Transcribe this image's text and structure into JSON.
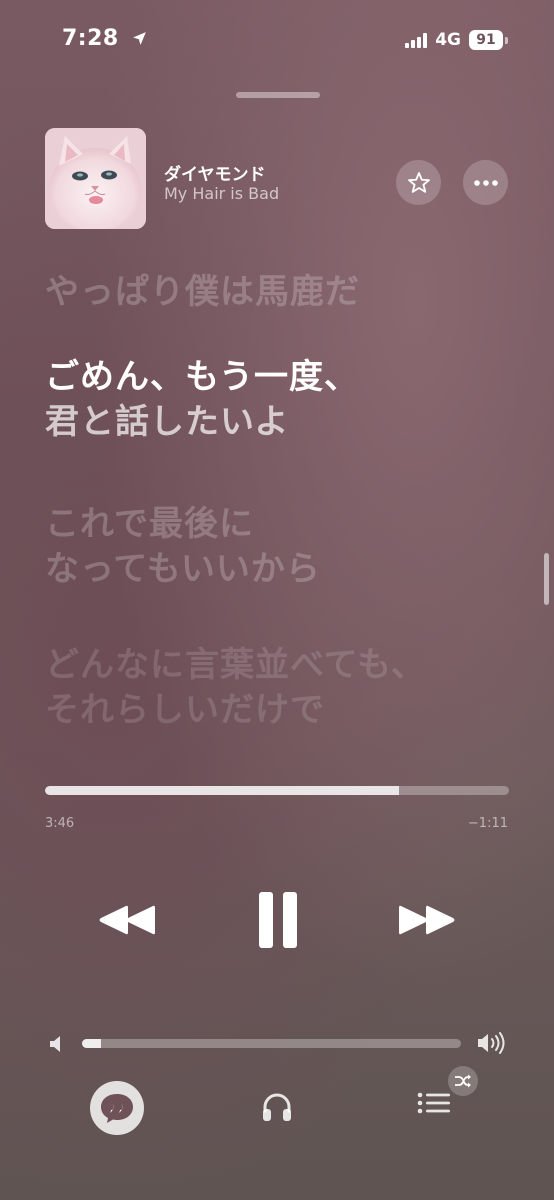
{
  "status_bar": {
    "time": "7:28",
    "network": "4G",
    "battery": "91"
  },
  "now_playing": {
    "title": "ダイヤモンド",
    "artist": "My Hair is Bad",
    "artwork_icon": "album-artwork-cat"
  },
  "lyrics": {
    "previous_line": "やっぱり僕は馬鹿だ",
    "current_line_1": "ごめん、もう一度、",
    "current_line_2": "君と話したいよ",
    "next_line_1": "これで最後に",
    "next_line_2": "なってもいいから",
    "later_line_1": "どんなに言葉並べても、",
    "later_line_2": "それらしいだけで"
  },
  "playback": {
    "elapsed": "3:46",
    "remaining": "−1:11",
    "progress_fraction": 0.762,
    "state": "playing"
  },
  "volume": {
    "level_fraction": 0.05
  },
  "icons": {
    "location": "location-arrow-icon",
    "star": "star-icon",
    "more": "ellipsis-icon",
    "rewind": "rewind-icon",
    "pause": "pause-icon",
    "forward": "fast-forward-icon",
    "volume_low": "speaker-low-icon",
    "volume_high": "speaker-high-icon",
    "lyrics": "quote-bubble-icon",
    "airplay": "headphones-icon",
    "queue": "list-icon",
    "shuffle": "shuffle-icon"
  }
}
